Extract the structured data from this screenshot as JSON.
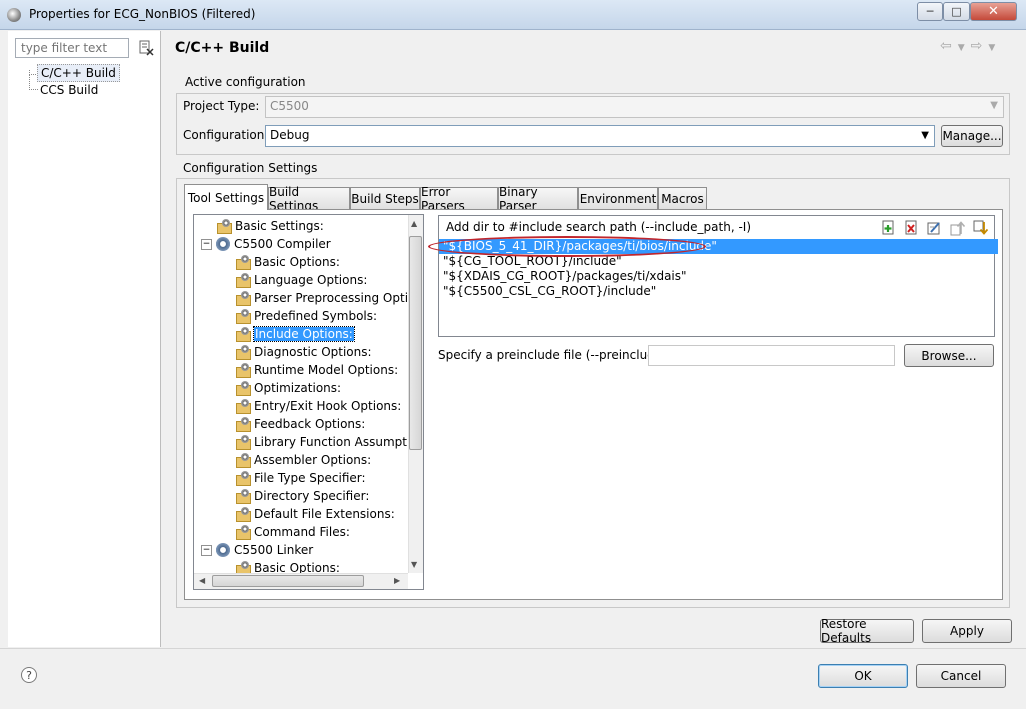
{
  "window": {
    "title": "Properties for ECG_NonBIOS (Filtered)"
  },
  "filter": {
    "placeholder": "type filter text"
  },
  "nav": {
    "items": [
      "C/C++ Build",
      "CCS Build"
    ]
  },
  "page": {
    "title": "C/C++ Build"
  },
  "active_config": {
    "group_label": "Active configuration",
    "project_type_label": "Project Type:",
    "project_type_value": "C5500",
    "configuration_label": "Configuration:",
    "configuration_value": "Debug",
    "manage_label": "Manage..."
  },
  "config_settings": {
    "group_label": "Configuration Settings"
  },
  "tabs": [
    "Tool Settings",
    "Build Settings",
    "Build Steps",
    "Error Parsers",
    "Binary Parser",
    "Environment",
    "Macros"
  ],
  "tree": {
    "basic_settings": "Basic Settings:",
    "compiler": "C5500 Compiler",
    "compiler_children": [
      "Basic Options:",
      "Language Options:",
      "Parser Preprocessing Option",
      "Predefined Symbols:",
      "Include Options:",
      "Diagnostic Options:",
      "Runtime Model Options:",
      "Optimizations:",
      "Entry/Exit Hook Options:",
      "Feedback Options:",
      "Library Function Assumption",
      "Assembler Options:",
      "File Type Specifier:",
      "Directory Specifier:",
      "Default File Extensions:",
      "Command Files:"
    ],
    "linker": "C5500 Linker",
    "linker_children": [
      "Basic Options:"
    ]
  },
  "include": {
    "header": "Add dir to #include search path (--include_path, -I)",
    "paths": [
      "\"${BIOS_5_41_DIR}/packages/ti/bios/include\"",
      "\"${CG_TOOL_ROOT}/include\"",
      "\"${XDAIS_CG_ROOT}/packages/ti/xdais\"",
      "\"${C5500_CSL_CG_ROOT}/include\""
    ],
    "preinclude_label": "Specify a preinclude file (--preinclude)",
    "preinclude_value": "",
    "browse_label": "Browse..."
  },
  "buttons": {
    "restore_defaults": "Restore Defaults",
    "apply": "Apply",
    "ok": "OK",
    "cancel": "Cancel"
  },
  "colors": {
    "selection": "#3399ff",
    "highlight_ellipse": "#c0262d"
  }
}
